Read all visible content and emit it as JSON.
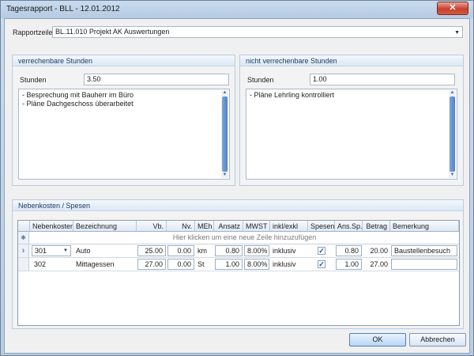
{
  "window": {
    "title": "Tagesrapport - BLL - 12.01.2012",
    "close_glyph": "✕"
  },
  "rapportzeile": {
    "label": "Rapportzeile",
    "value": "BL.11.010 Projekt AK Auswertungen"
  },
  "verrechenbar": {
    "header": "verrechenbare Stunden",
    "stunden_label": "Stunden",
    "stunden_value": "3.50",
    "notes": "- Besprechung mit Bauherr im Büro\n- Pläne Dachgeschoss überarbeitet"
  },
  "nicht_verrechenbar": {
    "header": "nicht verrechenbare Stunden",
    "stunden_label": "Stunden",
    "stunden_value": "1.00",
    "notes": "- Pläne Lehrling kontrolliert"
  },
  "nebenkosten": {
    "header": "Nebenkosten / Spesen",
    "columns": [
      "Nebenkosten",
      "Bezeichnung",
      "Vb.",
      "Nv.",
      "MEh",
      "Ansatz",
      "MWST",
      "inkl/exkl",
      "Spesen",
      "Ans.Sp.",
      "Betrag",
      "Bemerkung"
    ],
    "new_row_text": "Hier klicken um eine neue Zeile hinzuzufügen",
    "rows": [
      {
        "indicator": "›",
        "nebenkosten": "301",
        "bezeichnung": "Auto",
        "vb": "25.00",
        "nv": "0.00",
        "meh": "km",
        "ansatz": "0.80",
        "mwst": "8.00%",
        "inkl": "inklusiv",
        "spesen": true,
        "ans_sp": "0.80",
        "betrag": "20.00",
        "bemerkung": "Baustellenbesuch"
      },
      {
        "indicator": "",
        "nebenkosten": "302",
        "bezeichnung": "Mittagessen",
        "vb": "27.00",
        "nv": "0.00",
        "meh": "St",
        "ansatz": "1.00",
        "mwst": "8.00%",
        "inkl": "inklusiv",
        "spesen": true,
        "ans_sp": "1.00",
        "betrag": "27.00",
        "bemerkung": ""
      }
    ]
  },
  "buttons": {
    "ok": "OK",
    "cancel": "Abbrechen"
  },
  "glyphs": {
    "dropdown": "▼",
    "check": "✓",
    "new_row_marker": "✱",
    "scroll_up": "▲",
    "scroll_down": "▼"
  },
  "colors": {
    "accent": "#4f82c4",
    "group_header_text": "#1f3a66",
    "close_button": "#c8402c"
  }
}
